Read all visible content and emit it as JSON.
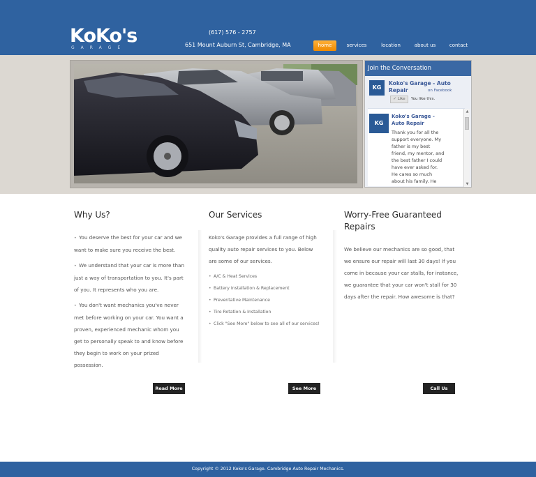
{
  "header": {
    "logo_text": "KoKo's",
    "logo_subtext": "GARAGE",
    "phone": "(617) 576 - 2757",
    "address": "651 Mount Auburn St, Cambridge, MA",
    "nav": [
      "home",
      "services",
      "location",
      "about us",
      "contact"
    ],
    "active_nav": "home"
  },
  "facebook": {
    "heading": "Join the Conversation",
    "avatar_text": "KG",
    "page_name": "Koko's Garage - Auto Repair",
    "on_facebook": "on Facebook",
    "like_button": "Like",
    "like_status": "You like this.",
    "post_author": "Koko's Garage - Auto Repair",
    "post_text": "Thank you for all the support everyone. My father is my best friend, my mentor, and the best father I could have ever asked for. He cares so much about his family. He always cared about his"
  },
  "columns": {
    "why": {
      "title": "Why Us?",
      "paragraphs": [
        "You deserve the best for your car and we want to make sure you receive the best.",
        "We understand that your car is more than just a way of transportation to you. It's part of you. It represents who you are.",
        "You don't want mechanics you've never met before working on your car. You want a proven, experienced mechanic whom you get to personally speak to and know before they begin to work on your prized possession."
      ],
      "button": "Read More"
    },
    "services": {
      "title": "Our Services",
      "intro": "Koko's Garage provides a full range of high quality auto repair services to you. Below are some of our services.",
      "items": [
        "A/C & Heat Services",
        "Battery Installation & Replacement",
        "Preventative Maintenance",
        "Tire Rotation & Installation",
        "Click \"See More\" below to see all of our services!"
      ],
      "button": "See More"
    },
    "guarantee": {
      "title": "Worry-Free Guaranteed Repairs",
      "text": "We believe our mechanics are so good, that we ensure our repair will last 30 days! If you come in because your car stalls, for instance, we guarantee that your car won't stall for 30 days after the repair. How awesome is that?",
      "button": "Call Us"
    }
  },
  "footer": {
    "text": "Copyright © 2012 Koko's Garage. Cambridge Auto Repair Mechanics."
  },
  "colors": {
    "brand_blue": "#2f62a0",
    "nav_active": "#f59a12",
    "button_dark": "#232323"
  }
}
